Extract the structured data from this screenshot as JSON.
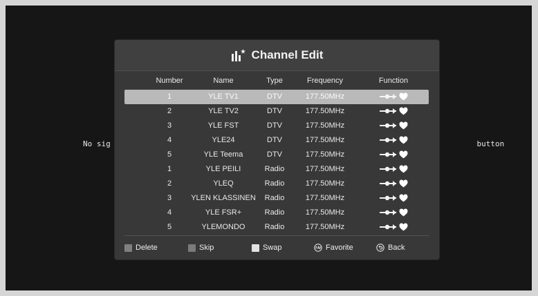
{
  "background": {
    "message": "No sig                                                                                button"
  },
  "dialog": {
    "title": "Channel Edit",
    "title_icon": "channel-edit-icon",
    "columns": {
      "number": "Number",
      "name": "Name",
      "type": "Type",
      "frequency": "Frequency",
      "function": "Function"
    },
    "rows": [
      {
        "number": "1",
        "name": "YLE TV1",
        "type": "DTV",
        "frequency": "177.50MHz",
        "function_icons": [
          "move-icon",
          "favorite-heart-icon"
        ],
        "selected": true
      },
      {
        "number": "2",
        "name": "YLE TV2",
        "type": "DTV",
        "frequency": "177.50MHz",
        "function_icons": [
          "move-icon",
          "favorite-heart-icon"
        ],
        "selected": false
      },
      {
        "number": "3",
        "name": "YLE FST",
        "type": "DTV",
        "frequency": "177.50MHz",
        "function_icons": [
          "move-icon",
          "favorite-heart-icon"
        ],
        "selected": false
      },
      {
        "number": "4",
        "name": "YLE24",
        "type": "DTV",
        "frequency": "177.50MHz",
        "function_icons": [
          "move-icon",
          "favorite-heart-icon"
        ],
        "selected": false
      },
      {
        "number": "5",
        "name": "YLE Teema",
        "type": "DTV",
        "frequency": "177.50MHz",
        "function_icons": [
          "move-icon",
          "favorite-heart-icon"
        ],
        "selected": false
      },
      {
        "number": "1",
        "name": "YLE PEILI",
        "type": "Radio",
        "frequency": "177.50MHz",
        "function_icons": [
          "move-icon",
          "favorite-heart-icon"
        ],
        "selected": false
      },
      {
        "number": "2",
        "name": "YLEQ",
        "type": "Radio",
        "frequency": "177.50MHz",
        "function_icons": [
          "move-icon",
          "favorite-heart-icon"
        ],
        "selected": false
      },
      {
        "number": "3",
        "name": "YLEN KLASSINEN",
        "type": "Radio",
        "frequency": "177.50MHz",
        "function_icons": [
          "move-icon",
          "favorite-heart-icon"
        ],
        "selected": false
      },
      {
        "number": "4",
        "name": "YLE FSR+",
        "type": "Radio",
        "frequency": "177.50MHz",
        "function_icons": [
          "move-icon",
          "favorite-heart-icon"
        ],
        "selected": false
      },
      {
        "number": "5",
        "name": "YLEMONDO",
        "type": "Radio",
        "frequency": "177.50MHz",
        "function_icons": [
          "move-icon",
          "favorite-heart-icon"
        ],
        "selected": false
      }
    ],
    "footer": {
      "delete": {
        "label": "Delete",
        "key_color": "#808080",
        "icon": "color-key-icon"
      },
      "skip": {
        "label": "Skip",
        "key_color": "#7b7b7b",
        "icon": "color-key-icon"
      },
      "swap": {
        "label": "Swap",
        "key_color": "#e3e3e3",
        "icon": "color-key-icon"
      },
      "favorite": {
        "label": "Favorite",
        "icon": "fav-button-icon"
      },
      "back": {
        "label": "Back",
        "icon": "back-button-icon"
      }
    }
  },
  "colors": {
    "screen_background": "#161616",
    "dialog_background": "#383838",
    "header_background": "#404040",
    "selected_row": "#b9b9b9",
    "text": "#e9e9e9"
  }
}
